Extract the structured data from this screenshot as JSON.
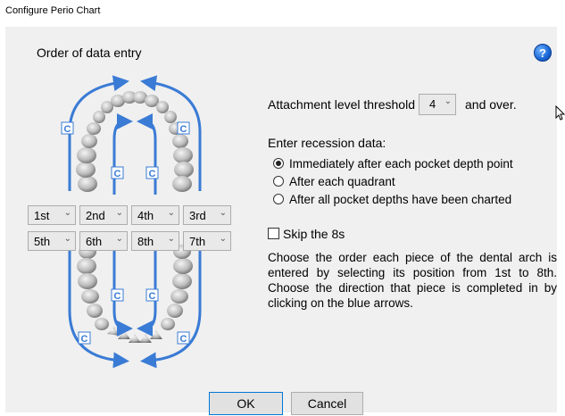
{
  "window": {
    "title": "Configure Perio Chart"
  },
  "section_title": "Order of data entry",
  "help_icon": "question-circle-icon",
  "order_selects": {
    "upper": [
      "1st",
      "2nd",
      "4th",
      "3rd"
    ],
    "lower": [
      "5th",
      "6th",
      "8th",
      "7th"
    ]
  },
  "threshold": {
    "label_before": "Attachment level threshold",
    "value": "4",
    "label_after": "and over."
  },
  "recession": {
    "title": "Enter recession data:",
    "options": [
      {
        "label": "Immediately after each pocket depth point",
        "selected": true
      },
      {
        "label": "After each quadrant",
        "selected": false
      },
      {
        "label": "After all pocket depths have been charted",
        "selected": false
      }
    ]
  },
  "skip8": {
    "label": "Skip the 8s",
    "checked": false
  },
  "description": "Choose the order each piece of the dental arch is entered by selecting its position from 1st to 8th. Choose the direction that piece is completed in by clicking on the blue arrows.",
  "buttons": {
    "ok": "OK",
    "cancel": "Cancel"
  },
  "colors": {
    "arrow_blue": "#3a7bd5",
    "panel_bg": "#f0f0f0",
    "button_bg": "#e1e1e1"
  }
}
